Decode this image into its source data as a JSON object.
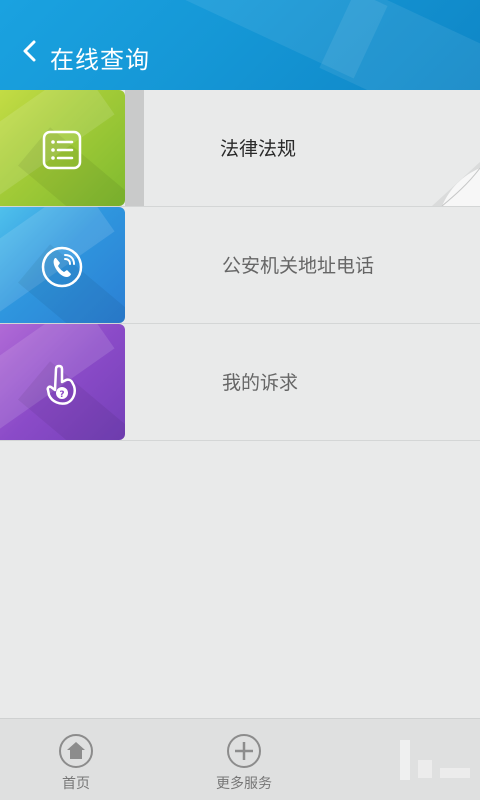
{
  "header": {
    "title": "在线查询",
    "back_icon": "chevron-left-icon",
    "background": "#1597d6"
  },
  "menu": {
    "items": [
      {
        "label": "法律法规",
        "icon": "list-icon",
        "color": "#a5cc38",
        "active": true
      },
      {
        "label": "公安机关地址电话",
        "icon": "phone-icon",
        "color": "#2f96de",
        "active": false
      },
      {
        "label": "我的诉求",
        "icon": "hand-question-icon",
        "color": "#8b4bc8",
        "active": false
      }
    ]
  },
  "bottom_nav": {
    "items": [
      {
        "label": "首页",
        "icon": "home-icon"
      },
      {
        "label": "更多服务",
        "icon": "plus-circle-icon"
      }
    ]
  }
}
